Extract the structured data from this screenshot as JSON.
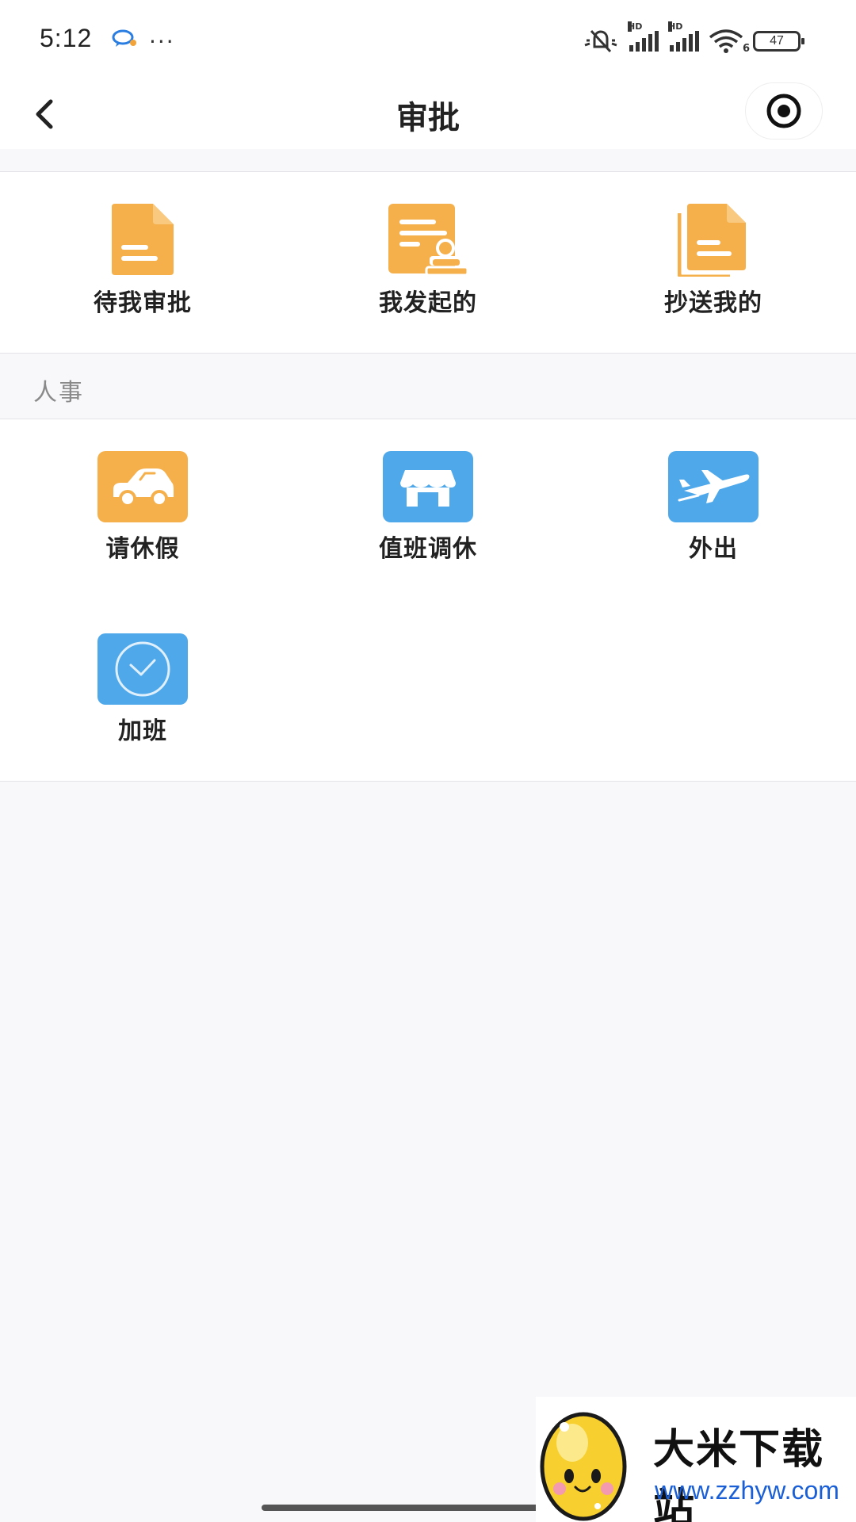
{
  "status_bar": {
    "time": "5:12",
    "more": "···",
    "battery": "47",
    "network_labels": [
      "HD",
      "HD"
    ],
    "wifi_badge": "6"
  },
  "nav": {
    "title": "审批"
  },
  "quick_actions": [
    {
      "label": "待我审批",
      "icon": "document-icon",
      "color": "#f5b04c"
    },
    {
      "label": "我发起的",
      "icon": "document-stamp-icon",
      "color": "#f5b04c"
    },
    {
      "label": "抄送我的",
      "icon": "documents-copy-icon",
      "color": "#f5b04c"
    }
  ],
  "hr_section": {
    "title": "人事",
    "items": [
      {
        "label": "请休假",
        "icon": "car-icon",
        "color": "#f5b04c"
      },
      {
        "label": "值班调休",
        "icon": "storefront-icon",
        "color": "#4ea8ea"
      },
      {
        "label": "外出",
        "icon": "airplane-icon",
        "color": "#4ea8ea"
      },
      {
        "label": "加班",
        "icon": "clock-icon",
        "color": "#4ea8ea"
      }
    ]
  },
  "watermark": {
    "name": "大米下载站",
    "url": "www.zzhyw.com"
  }
}
